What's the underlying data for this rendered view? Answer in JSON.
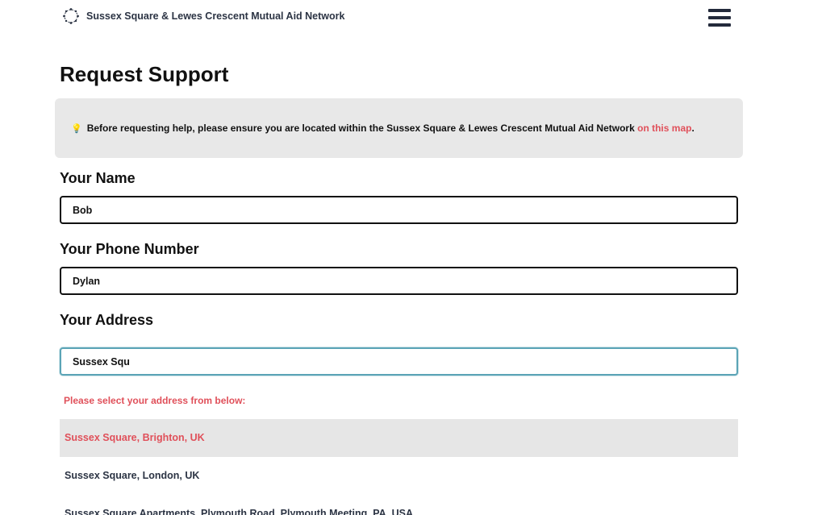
{
  "header": {
    "brand": "Sussex Square & Lewes Crescent Mutual Aid Network",
    "logo_icon": "network-circle-icon",
    "menu_icon": "hamburger-menu-icon"
  },
  "page": {
    "title": "Request Support"
  },
  "notice": {
    "icon": "lightbulb-icon",
    "text": "Before requesting help, please ensure you are located within the Sussex Square & Lewes Crescent Mutual Aid Network ",
    "link_text": "on this map",
    "suffix": "."
  },
  "form": {
    "name_label": "Your Name",
    "name_value": "Bob",
    "phone_label": "Your Phone Number",
    "phone_value": "Dylan",
    "address_label": "Your Address",
    "address_value": "Sussex Squ",
    "address_hint": "Please select your address from below:",
    "suggestions": [
      "Sussex Square, Brighton, UK",
      "Sussex Square, London, UK",
      "Sussex Square Apartments, Plymouth Road, Plymouth Meeting, PA, USA"
    ]
  },
  "colors": {
    "accent": "#e0505a",
    "focus_border": "#5ba4b6",
    "notice_bg": "#e8e8e8",
    "brand_text": "#2c3444"
  }
}
